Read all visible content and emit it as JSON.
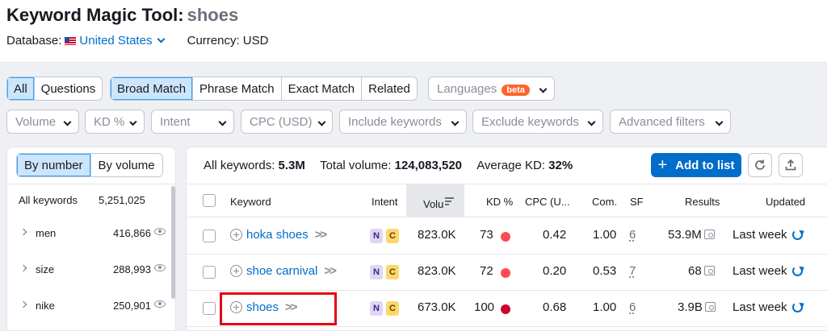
{
  "header": {
    "title": "Keyword Magic Tool:",
    "keyword": "shoes",
    "database_label": "Database:",
    "database_value": "United States",
    "currency": "Currency: USD"
  },
  "filters_row1": {
    "all": "All",
    "questions": "Questions",
    "broad_match": "Broad Match",
    "phrase_match": "Phrase Match",
    "exact_match": "Exact Match",
    "related": "Related",
    "languages": "Languages",
    "beta": "beta"
  },
  "filters_row2": {
    "volume": "Volume",
    "kd": "KD %",
    "intent": "Intent",
    "cpc": "CPC (USD)",
    "include": "Include keywords",
    "exclude": "Exclude keywords",
    "advanced": "Advanced filters"
  },
  "sidebar": {
    "by_number": "By number",
    "by_volume": "By volume",
    "all_label": "All keywords",
    "all_count": "5,251,025",
    "groups": [
      {
        "label": "men",
        "count": "416,866"
      },
      {
        "label": "size",
        "count": "288,993"
      },
      {
        "label": "nike",
        "count": "250,901"
      }
    ]
  },
  "summary": {
    "all_label": "All keywords:",
    "all_value": "5.3M",
    "volume_label": "Total volume:",
    "volume_value": "124,083,520",
    "kd_label": "Average KD:",
    "kd_value": "32%"
  },
  "toolbar": {
    "add_to_list": "Add to list",
    "plus": "+"
  },
  "table": {
    "headers": {
      "keyword": "Keyword",
      "intent": "Intent",
      "volume": "Volu",
      "kd": "KD %",
      "cpc": "CPC (U...",
      "com": "Com.",
      "sf": "SF",
      "results": "Results",
      "updated": "Updated"
    },
    "rows": [
      {
        "keyword": "hoka shoes",
        "intent1": "N",
        "intent2": "C",
        "volume": "823.0K",
        "kd": "73",
        "kd_color": "#ff4953",
        "cpc": "0.42",
        "com": "1.00",
        "sf": "6",
        "results": "53.9M",
        "updated": "Last week"
      },
      {
        "keyword": "shoe carnival",
        "intent1": "N",
        "intent2": "C",
        "volume": "823.0K",
        "kd": "72",
        "kd_color": "#ff4953",
        "cpc": "0.20",
        "com": "0.53",
        "sf": "7",
        "results": "68",
        "updated": "Last week"
      },
      {
        "keyword": "shoes",
        "intent1": "N",
        "intent2": "C",
        "volume": "673.0K",
        "kd": "100",
        "kd_color": "#d1002f",
        "cpc": "0.68",
        "com": "1.00",
        "sf": "6",
        "results": "3.9B",
        "updated": "Last week"
      }
    ]
  },
  "colors": {
    "accent": "#006dca",
    "highlight": "#e30613"
  }
}
